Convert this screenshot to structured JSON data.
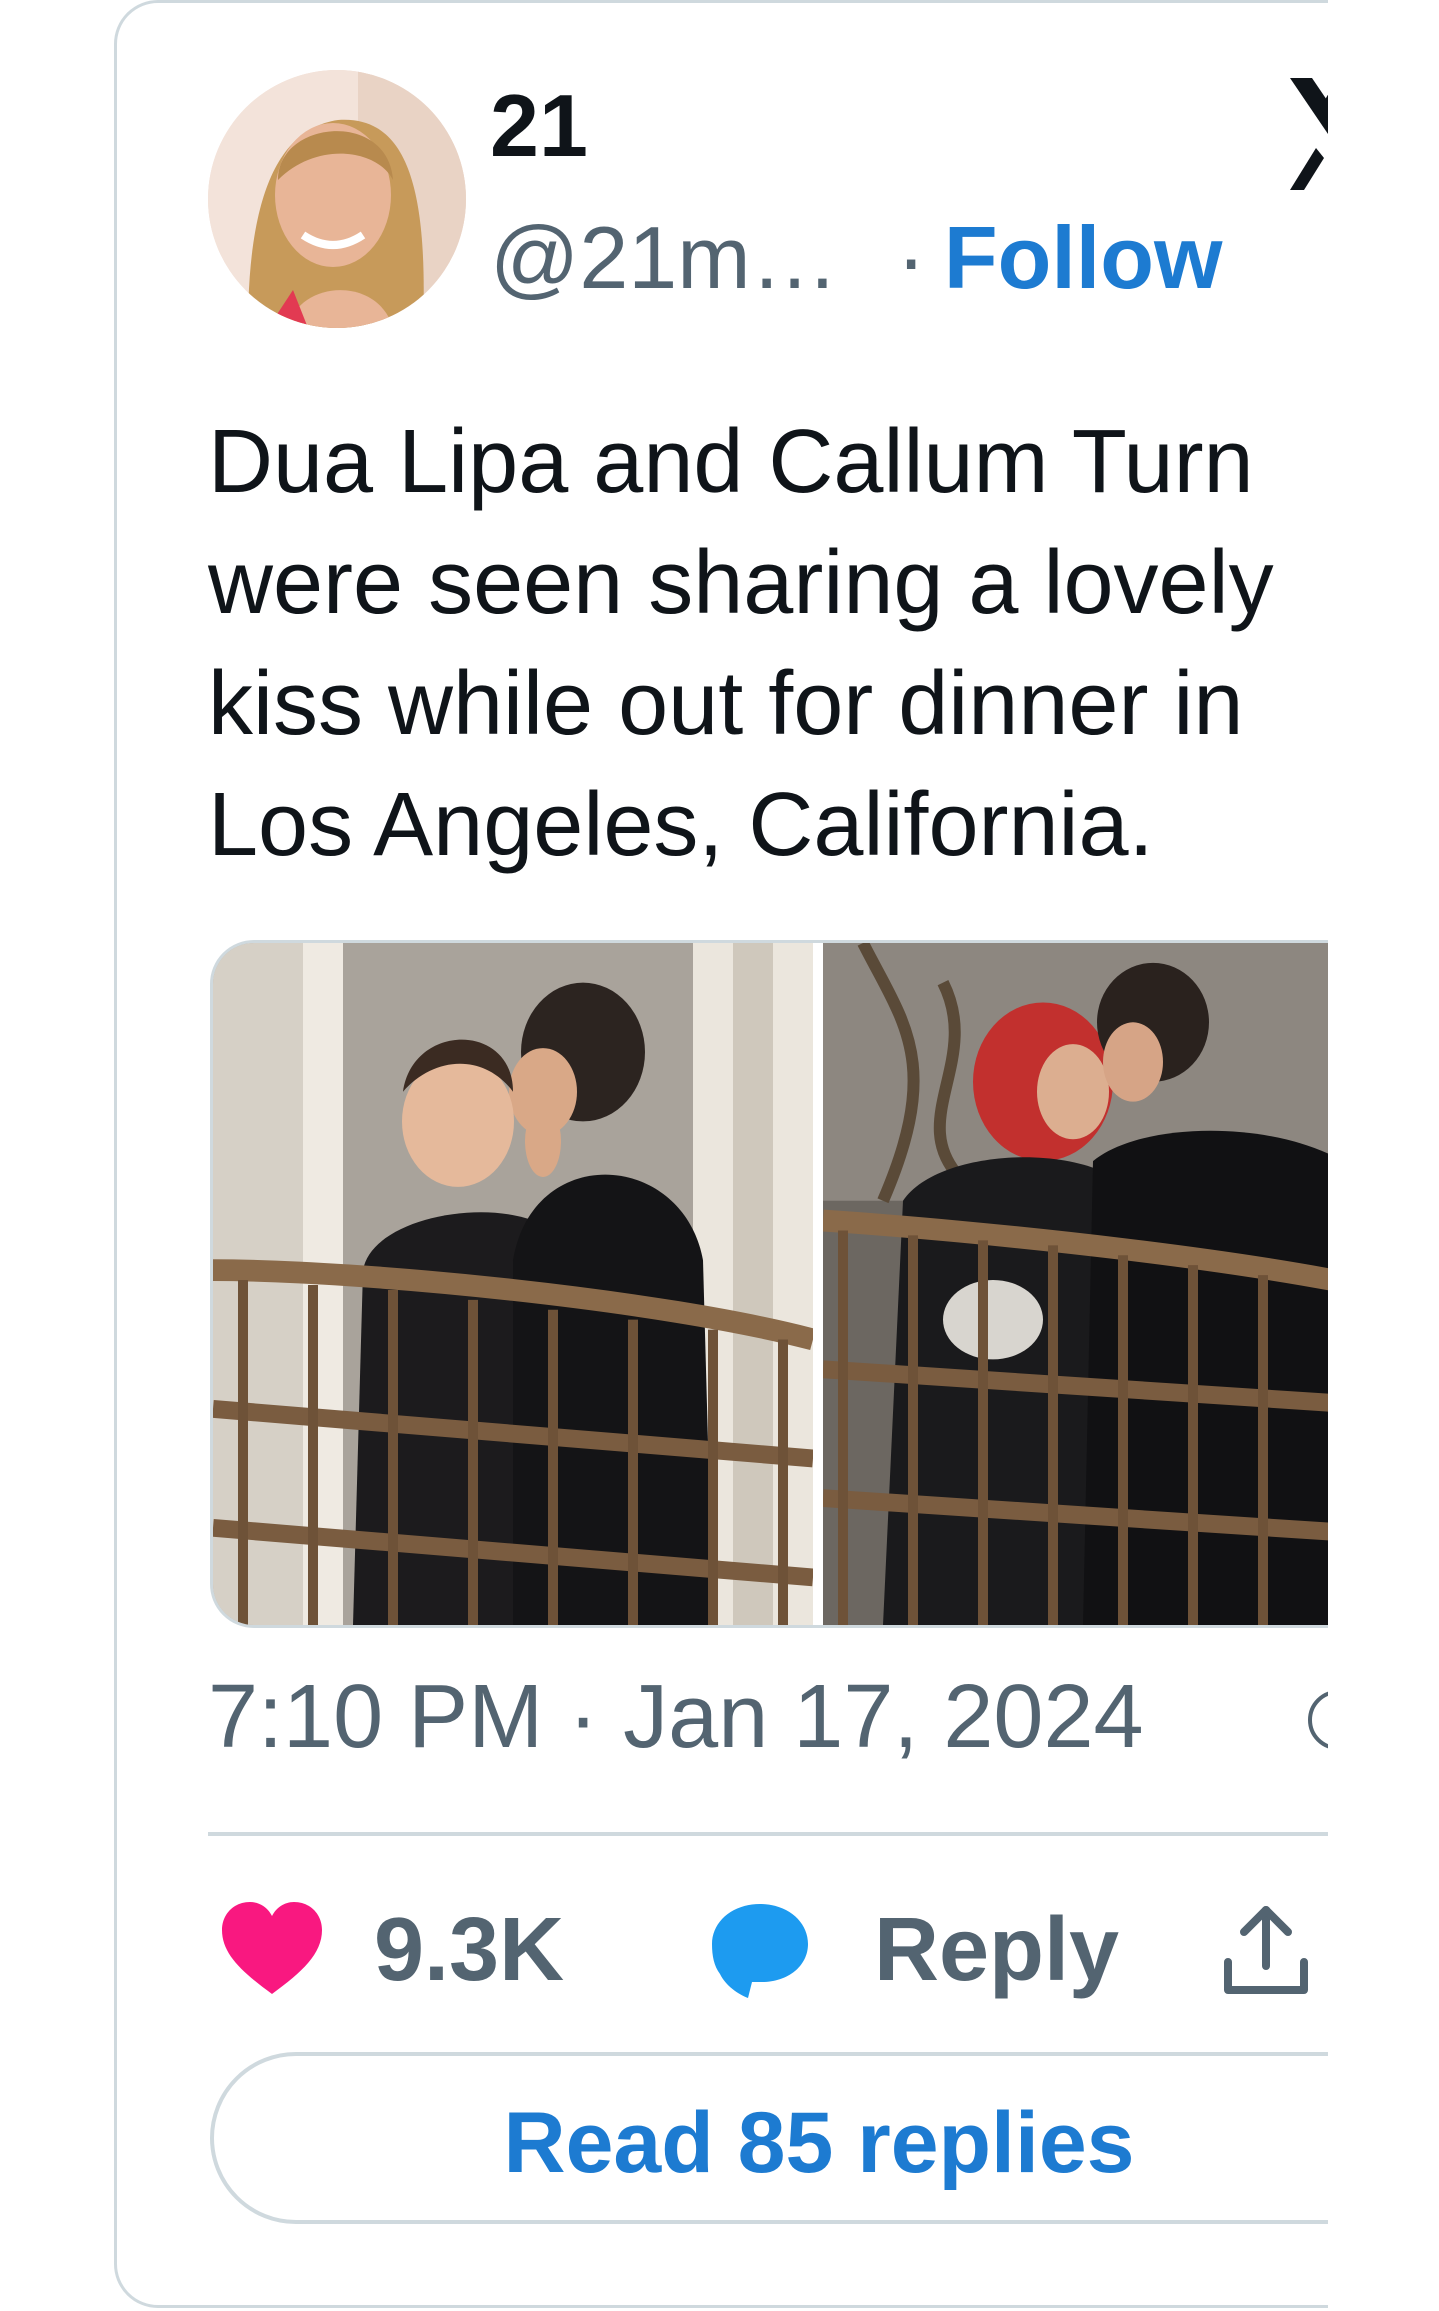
{
  "author": {
    "display_name": "21",
    "handle": "@21m…",
    "separator": "·",
    "follow_label": "Follow"
  },
  "tweet": {
    "lines": [
      "Dua Lipa and Callum Turn",
      "were seen sharing a lovely",
      "kiss while out for dinner in",
      "Los Angeles, California."
    ],
    "timestamp": "7:10 PM · Jan 17, 2024"
  },
  "icons": {
    "x_logo": "x-logo-icon",
    "info": "info-icon",
    "like": "heart-icon",
    "reply": "speech-bubble-icon",
    "share": "share-upload-icon"
  },
  "actions": {
    "like_count": "9.3K",
    "reply_label": "Reply"
  },
  "read_replies_label": "Read 85 replies",
  "colors": {
    "link_blue": "#1d7bd1",
    "like_pink": "#f91880",
    "reply_blue": "#1d9bf0",
    "muted_gray": "#536471",
    "border": "#cfd9de"
  }
}
